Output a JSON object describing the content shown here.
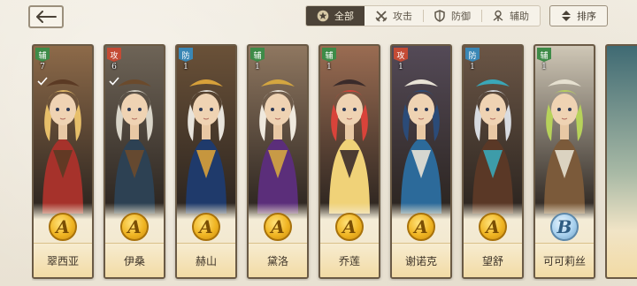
{
  "nav": {
    "back_icon": "back-arrow-icon"
  },
  "filters": {
    "tabs": [
      {
        "label": "全部",
        "icon": "star-icon",
        "active": true
      },
      {
        "label": "攻击",
        "icon": "crossed-swords-icon",
        "active": false
      },
      {
        "label": "防御",
        "icon": "shield-icon",
        "active": false
      },
      {
        "label": "辅助",
        "icon": "support-icon",
        "active": false
      }
    ],
    "sort_label": "排序",
    "sort_icon": "sort-arrows-icon"
  },
  "colors": {
    "support": "#3e8b48",
    "attack": "#c44b35",
    "defense": "#3a87b5",
    "grade_A": "#f0b523",
    "grade_B": "#a9d1ee"
  },
  "heroes": [
    {
      "name": "翠西亚",
      "role_label": "辅",
      "role": "support",
      "level": "7",
      "grade": "A",
      "owned_mark": true,
      "palette": {
        "hair": "#e7bf6a",
        "cloth": "#a6322b",
        "accent": "#5b3a24",
        "bg": "#8d6a49"
      }
    },
    {
      "name": "伊桑",
      "role_label": "攻",
      "role": "attack",
      "level": "6",
      "grade": "A",
      "owned_mark": true,
      "palette": {
        "hair": "#d9d5c9",
        "cloth": "#2d4153",
        "accent": "#6b4a2c",
        "bg": "#6e6457"
      }
    },
    {
      "name": "赫山",
      "role_label": "防",
      "role": "defense",
      "level": "1",
      "grade": "A",
      "owned_mark": false,
      "palette": {
        "hair": "#e8e4dc",
        "cloth": "#1f3a6b",
        "accent": "#d8a13a",
        "bg": "#6a5138"
      }
    },
    {
      "name": "黛洛",
      "role_label": "辅",
      "role": "support",
      "level": "1",
      "grade": "A",
      "owned_mark": false,
      "palette": {
        "hair": "#efe9de",
        "cloth": "#5b2e7a",
        "accent": "#d4a640",
        "bg": "#8f7760"
      }
    },
    {
      "name": "乔莲",
      "role_label": "辅",
      "role": "support",
      "level": "1",
      "grade": "A",
      "owned_mark": false,
      "palette": {
        "hair": "#d9433a",
        "cloth": "#f0d278",
        "accent": "#3a2b2a",
        "bg": "#9a6c52"
      }
    },
    {
      "name": "谢诺克",
      "role_label": "攻",
      "role": "attack",
      "level": "1",
      "grade": "A",
      "owned_mark": false,
      "palette": {
        "hair": "#2b4b78",
        "cloth": "#2c6a9a",
        "accent": "#e9e3d6",
        "bg": "#544a57"
      }
    },
    {
      "name": "望舒",
      "role_label": "防",
      "role": "defense",
      "level": "1",
      "grade": "A",
      "owned_mark": false,
      "palette": {
        "hair": "#d8dbe0",
        "cloth": "#5a3826",
        "accent": "#3aa7b8",
        "bg": "#6b5646"
      }
    },
    {
      "name": "可可莉丝",
      "role_label": "辅",
      "role": "support",
      "level": "1",
      "grade": "B",
      "owned_mark": false,
      "palette": {
        "hair": "#b7d25a",
        "cloth": "#7b5a3a",
        "accent": "#e6e0d0",
        "bg": "#cfc7b6"
      }
    }
  ]
}
